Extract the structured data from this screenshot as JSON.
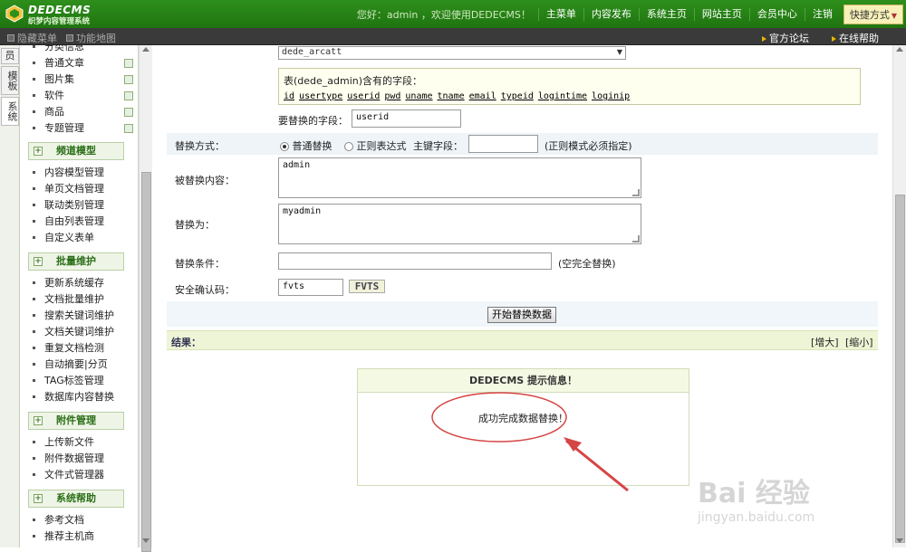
{
  "header": {
    "logo_title": "DEDECMS",
    "logo_subtitle": "织梦内容管理系统",
    "greeting": "您好：admin ，欢迎使用DEDECMS！",
    "nav": [
      "主菜单",
      "内容发布",
      "系统主页",
      "网站主页",
      "会员中心",
      "注销"
    ],
    "quick": "快捷方式"
  },
  "subbar": {
    "hide_menu": "隐藏菜单",
    "site_map": "功能地图",
    "forum": "官方论坛",
    "help": "在线帮助"
  },
  "left_tabs": [
    "员",
    "模板",
    "系统"
  ],
  "menu": {
    "top_items": [
      "分类信息",
      "普通文章",
      "图片集",
      "软件",
      "商品",
      "专题管理"
    ],
    "sections": [
      {
        "title": "频道模型",
        "items": [
          "内容模型管理",
          "单页文档管理",
          "联动类别管理",
          "自由列表管理",
          "自定义表单"
        ]
      },
      {
        "title": "批量维护",
        "items": [
          "更新系统缓存",
          "文档批量维护",
          "搜索关键词维护",
          "文档关键词维护",
          "重复文档检测",
          "自动摘要|分页",
          "TAG标签管理",
          "数据库内容替换"
        ]
      },
      {
        "title": "附件管理",
        "items": [
          "上传新文件",
          "附件数据管理",
          "文件式管理器"
        ]
      },
      {
        "title": "系统帮助",
        "items": [
          "参考文档",
          "推荐主机商"
        ]
      }
    ]
  },
  "form": {
    "table_select": "dede_arcatt",
    "fields_intro": "表(dede_admin)含有的字段：",
    "fields": [
      "id",
      "usertype",
      "userid",
      "pwd",
      "uname",
      "tname",
      "email",
      "typeid",
      "logintime",
      "loginip"
    ],
    "field_label": "要替换的字段：",
    "field_value": "userid",
    "method_label": "替换方式：",
    "method_normal": "普通替换",
    "method_regex": "正则表达式",
    "pk_label": "主键字段：",
    "pk_value": "",
    "regex_note": "(正则模式必须指定)",
    "find_label": "被替换内容：",
    "find_value": "admin",
    "replace_label": "替换为：",
    "replace_value": "myadmin",
    "cond_label": "替换条件：",
    "cond_value": "",
    "cond_note": "(空完全替换)",
    "captcha_label": "安全确认码：",
    "captcha_value": "fvts",
    "captcha_image": "FVTS",
    "submit": "开始替换数据"
  },
  "result": {
    "label": "结果：",
    "enlarge": "[增大]",
    "shrink": "[缩小]"
  },
  "message": {
    "title": "DEDECMS 提示信息！",
    "body": "成功完成数据替换！"
  },
  "watermark": {
    "brand": "Bai 经验",
    "url": "jingyan.baidu.com"
  }
}
